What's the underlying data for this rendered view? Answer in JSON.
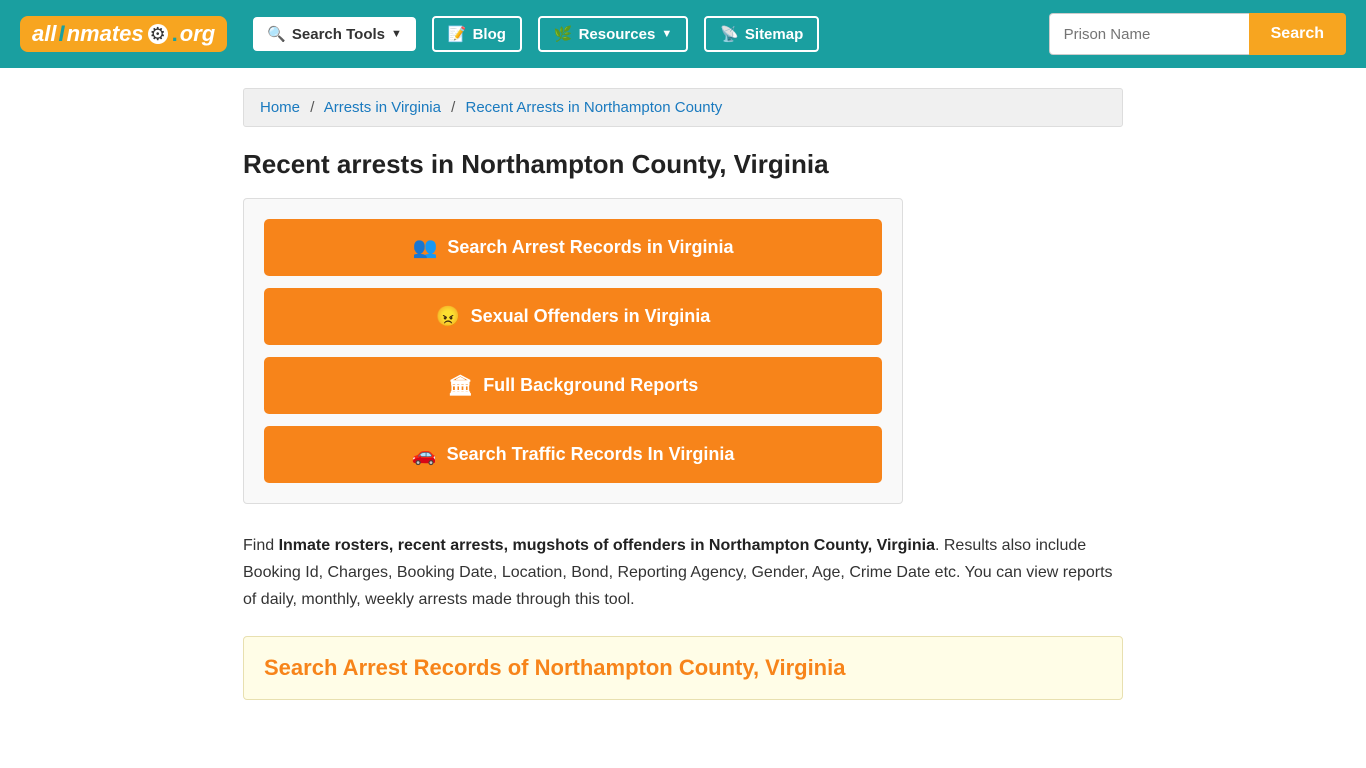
{
  "header": {
    "logo_all": "all",
    "logo_inmates": "Inmates",
    "logo_dot": ".",
    "logo_org": "org",
    "nav": {
      "search_tools": "Search Tools",
      "blog": "Blog",
      "resources": "Resources",
      "sitemap": "Sitemap"
    },
    "search": {
      "placeholder": "Prison Name",
      "button": "Search"
    }
  },
  "breadcrumb": {
    "home": "Home",
    "arrests_in_virginia": "Arrests in Virginia",
    "current": "Recent Arrests in Northampton County"
  },
  "page": {
    "title": "Recent arrests in Northampton County, Virginia"
  },
  "buttons": {
    "arrest_records": "Search Arrest Records in Virginia",
    "sexual_offenders": "Sexual Offenders in Virginia",
    "background_reports": "Full Background Reports",
    "traffic_records": "Search Traffic Records In Virginia"
  },
  "description": {
    "find_text": "Find ",
    "bold_text": "Inmate rosters, recent arrests, mugshots of offenders in Northampton County, Virginia",
    "rest_text": ". Results also include Booking Id, Charges, Booking Date, Location, Bond, Reporting Agency, Gender, Age, Crime Date etc. You can view reports of daily, monthly, weekly arrests made through this tool."
  },
  "search_section": {
    "title": "Search Arrest Records of Northampton County, Virginia"
  },
  "icons": {
    "search_tools": "🔍",
    "blog": "📝",
    "resources": "🌿",
    "sitemap": "📡",
    "people": "👥",
    "angry": "😠",
    "building": "🏛",
    "car": "🚗",
    "dropdown_arrow": "▼"
  }
}
